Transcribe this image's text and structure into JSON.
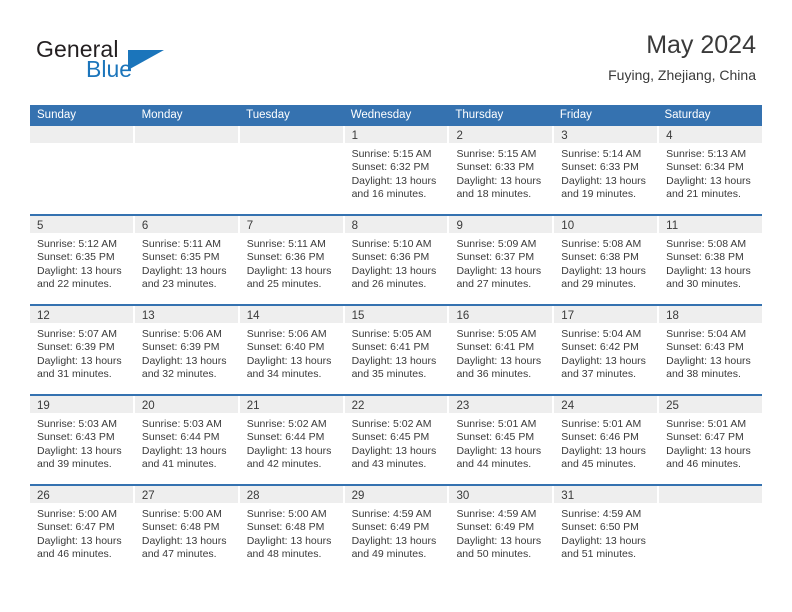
{
  "brand": {
    "name_part1": "General",
    "name_part2": "Blue",
    "flag_icon": "triangle-flag-icon",
    "colors": {
      "blue": "#1b75bb",
      "dark": "#231f20"
    }
  },
  "header": {
    "title": "May 2024",
    "subtitle": "Fuying, Zhejiang, China"
  },
  "theme": {
    "header_bar": "#3572b0",
    "row_divider": "#3572b0",
    "daynum_band": "#eeeeee",
    "text": "#3a3a3a"
  },
  "calendar": {
    "weekdays": [
      "Sunday",
      "Monday",
      "Tuesday",
      "Wednesday",
      "Thursday",
      "Friday",
      "Saturday"
    ],
    "weeks": [
      [
        {
          "day": ""
        },
        {
          "day": ""
        },
        {
          "day": ""
        },
        {
          "day": "1",
          "sunrise": "Sunrise: 5:15 AM",
          "sunset": "Sunset: 6:32 PM",
          "daylight": "Daylight: 13 hours and 16 minutes."
        },
        {
          "day": "2",
          "sunrise": "Sunrise: 5:15 AM",
          "sunset": "Sunset: 6:33 PM",
          "daylight": "Daylight: 13 hours and 18 minutes."
        },
        {
          "day": "3",
          "sunrise": "Sunrise: 5:14 AM",
          "sunset": "Sunset: 6:33 PM",
          "daylight": "Daylight: 13 hours and 19 minutes."
        },
        {
          "day": "4",
          "sunrise": "Sunrise: 5:13 AM",
          "sunset": "Sunset: 6:34 PM",
          "daylight": "Daylight: 13 hours and 21 minutes."
        }
      ],
      [
        {
          "day": "5",
          "sunrise": "Sunrise: 5:12 AM",
          "sunset": "Sunset: 6:35 PM",
          "daylight": "Daylight: 13 hours and 22 minutes."
        },
        {
          "day": "6",
          "sunrise": "Sunrise: 5:11 AM",
          "sunset": "Sunset: 6:35 PM",
          "daylight": "Daylight: 13 hours and 23 minutes."
        },
        {
          "day": "7",
          "sunrise": "Sunrise: 5:11 AM",
          "sunset": "Sunset: 6:36 PM",
          "daylight": "Daylight: 13 hours and 25 minutes."
        },
        {
          "day": "8",
          "sunrise": "Sunrise: 5:10 AM",
          "sunset": "Sunset: 6:36 PM",
          "daylight": "Daylight: 13 hours and 26 minutes."
        },
        {
          "day": "9",
          "sunrise": "Sunrise: 5:09 AM",
          "sunset": "Sunset: 6:37 PM",
          "daylight": "Daylight: 13 hours and 27 minutes."
        },
        {
          "day": "10",
          "sunrise": "Sunrise: 5:08 AM",
          "sunset": "Sunset: 6:38 PM",
          "daylight": "Daylight: 13 hours and 29 minutes."
        },
        {
          "day": "11",
          "sunrise": "Sunrise: 5:08 AM",
          "sunset": "Sunset: 6:38 PM",
          "daylight": "Daylight: 13 hours and 30 minutes."
        }
      ],
      [
        {
          "day": "12",
          "sunrise": "Sunrise: 5:07 AM",
          "sunset": "Sunset: 6:39 PM",
          "daylight": "Daylight: 13 hours and 31 minutes."
        },
        {
          "day": "13",
          "sunrise": "Sunrise: 5:06 AM",
          "sunset": "Sunset: 6:39 PM",
          "daylight": "Daylight: 13 hours and 32 minutes."
        },
        {
          "day": "14",
          "sunrise": "Sunrise: 5:06 AM",
          "sunset": "Sunset: 6:40 PM",
          "daylight": "Daylight: 13 hours and 34 minutes."
        },
        {
          "day": "15",
          "sunrise": "Sunrise: 5:05 AM",
          "sunset": "Sunset: 6:41 PM",
          "daylight": "Daylight: 13 hours and 35 minutes."
        },
        {
          "day": "16",
          "sunrise": "Sunrise: 5:05 AM",
          "sunset": "Sunset: 6:41 PM",
          "daylight": "Daylight: 13 hours and 36 minutes."
        },
        {
          "day": "17",
          "sunrise": "Sunrise: 5:04 AM",
          "sunset": "Sunset: 6:42 PM",
          "daylight": "Daylight: 13 hours and 37 minutes."
        },
        {
          "day": "18",
          "sunrise": "Sunrise: 5:04 AM",
          "sunset": "Sunset: 6:43 PM",
          "daylight": "Daylight: 13 hours and 38 minutes."
        }
      ],
      [
        {
          "day": "19",
          "sunrise": "Sunrise: 5:03 AM",
          "sunset": "Sunset: 6:43 PM",
          "daylight": "Daylight: 13 hours and 39 minutes."
        },
        {
          "day": "20",
          "sunrise": "Sunrise: 5:03 AM",
          "sunset": "Sunset: 6:44 PM",
          "daylight": "Daylight: 13 hours and 41 minutes."
        },
        {
          "day": "21",
          "sunrise": "Sunrise: 5:02 AM",
          "sunset": "Sunset: 6:44 PM",
          "daylight": "Daylight: 13 hours and 42 minutes."
        },
        {
          "day": "22",
          "sunrise": "Sunrise: 5:02 AM",
          "sunset": "Sunset: 6:45 PM",
          "daylight": "Daylight: 13 hours and 43 minutes."
        },
        {
          "day": "23",
          "sunrise": "Sunrise: 5:01 AM",
          "sunset": "Sunset: 6:45 PM",
          "daylight": "Daylight: 13 hours and 44 minutes."
        },
        {
          "day": "24",
          "sunrise": "Sunrise: 5:01 AM",
          "sunset": "Sunset: 6:46 PM",
          "daylight": "Daylight: 13 hours and 45 minutes."
        },
        {
          "day": "25",
          "sunrise": "Sunrise: 5:01 AM",
          "sunset": "Sunset: 6:47 PM",
          "daylight": "Daylight: 13 hours and 46 minutes."
        }
      ],
      [
        {
          "day": "26",
          "sunrise": "Sunrise: 5:00 AM",
          "sunset": "Sunset: 6:47 PM",
          "daylight": "Daylight: 13 hours and 46 minutes."
        },
        {
          "day": "27",
          "sunrise": "Sunrise: 5:00 AM",
          "sunset": "Sunset: 6:48 PM",
          "daylight": "Daylight: 13 hours and 47 minutes."
        },
        {
          "day": "28",
          "sunrise": "Sunrise: 5:00 AM",
          "sunset": "Sunset: 6:48 PM",
          "daylight": "Daylight: 13 hours and 48 minutes."
        },
        {
          "day": "29",
          "sunrise": "Sunrise: 4:59 AM",
          "sunset": "Sunset: 6:49 PM",
          "daylight": "Daylight: 13 hours and 49 minutes."
        },
        {
          "day": "30",
          "sunrise": "Sunrise: 4:59 AM",
          "sunset": "Sunset: 6:49 PM",
          "daylight": "Daylight: 13 hours and 50 minutes."
        },
        {
          "day": "31",
          "sunrise": "Sunrise: 4:59 AM",
          "sunset": "Sunset: 6:50 PM",
          "daylight": "Daylight: 13 hours and 51 minutes."
        },
        {
          "day": ""
        }
      ]
    ]
  }
}
